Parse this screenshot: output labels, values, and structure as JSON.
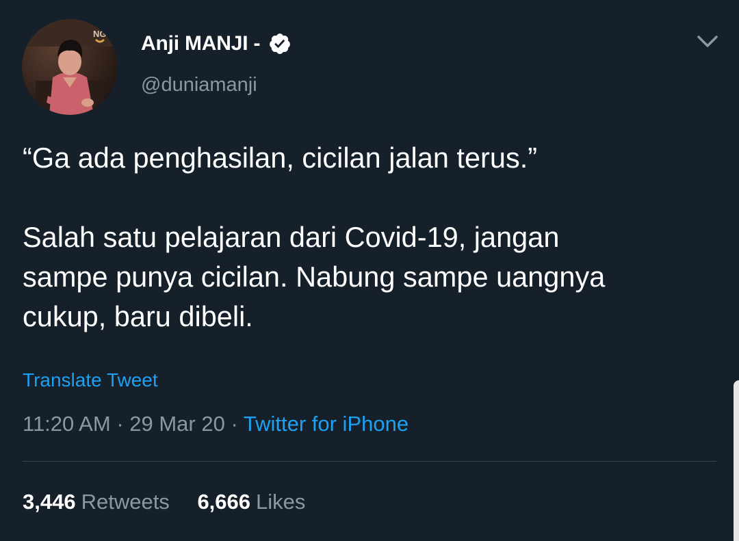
{
  "author": {
    "display_name": "Anji MANJI -",
    "handle": "@duniamanji",
    "verified": true,
    "avatar_text": "NG"
  },
  "tweet": {
    "text_line1": "“Ga ada penghasilan, cicilan jalan terus.”",
    "text_para2_line1": "Salah satu pelajaran dari Covid-19, jangan",
    "text_para2_line2": "sampe punya cicilan. Nabung sampe uangnya",
    "text_para2_line3": "cukup, baru dibeli.",
    "translate_label": "Translate Tweet",
    "time": "11:20 AM",
    "separator": "·",
    "date": "29 Mar 20",
    "source": "Twitter for iPhone"
  },
  "stats": {
    "retweets_count": "3,446",
    "retweets_label": "Retweets",
    "likes_count": "6,666",
    "likes_label": "Likes"
  },
  "icons": {
    "verified": "verified-badge-icon",
    "menu": "chevron-down-icon"
  },
  "colors": {
    "background": "#15202b",
    "text_primary": "#ffffff",
    "text_secondary": "#8899a6",
    "link": "#1da1f2",
    "divider": "#38444d"
  }
}
